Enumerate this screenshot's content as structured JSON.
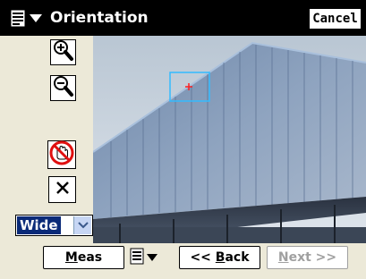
{
  "window": {
    "title": "Orientation",
    "cancel_label": "Cancel",
    "menu_icon": "document-menu-icon"
  },
  "toolbar": {
    "zoom_in_icon": "zoom-in-icon",
    "zoom_out_icon": "zoom-out-icon",
    "pan_icon": "hand-pan-icon",
    "clear_icon": "close-icon"
  },
  "zoom_select": {
    "selected": "Wide"
  },
  "bottom": {
    "meas_label": "Meas",
    "meas_ul": "M",
    "meas_rest": "eas",
    "back_label": "<< Back",
    "back_prefix": "<< ",
    "back_ul": "B",
    "back_rest": "ack",
    "next_label": "Next >>",
    "next_ul": "N",
    "next_rest": "ext >>",
    "next_enabled": false
  },
  "colors": {
    "title_bar": "#000000",
    "background": "#ece9d8",
    "selection": "#0a2a78",
    "target_box": "#33bbff",
    "crosshair": "#ff2020"
  }
}
